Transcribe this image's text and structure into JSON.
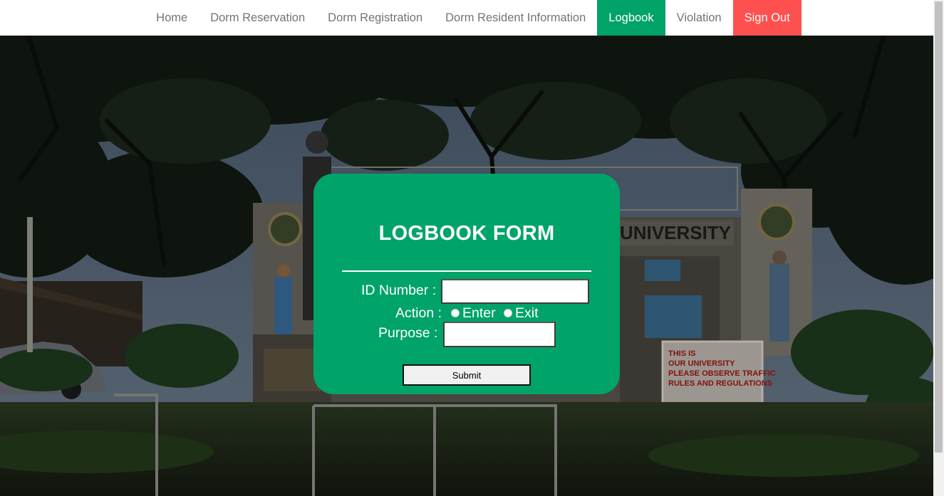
{
  "colors": {
    "accent_green": "#00A368",
    "signout_red": "#FF5050",
    "nav_text": "#747474"
  },
  "nav": {
    "items": [
      {
        "label": "Home"
      },
      {
        "label": "Dorm Reservation"
      },
      {
        "label": "Dorm Registration"
      },
      {
        "label": "Dorm Resident Information"
      },
      {
        "label": "Logbook",
        "active": true
      },
      {
        "label": "Violation"
      },
      {
        "label": "Sign Out",
        "style": "danger"
      }
    ]
  },
  "background": {
    "gate_sign": "UNIVERSITY",
    "notice_board": {
      "lines": [
        "THIS IS",
        "OUR UNIVERSITY",
        "PLEASE OBSERVE TRAFFIC",
        "RULES AND REGULATIONS"
      ]
    }
  },
  "form": {
    "title": "LOGBOOK FORM",
    "id_label": "ID Number :",
    "id_value": "",
    "action_label": "Action :",
    "action_options": [
      "Enter",
      "Exit"
    ],
    "purpose_label": "Purpose :",
    "purpose_value": "",
    "submit_label": "Submit"
  }
}
